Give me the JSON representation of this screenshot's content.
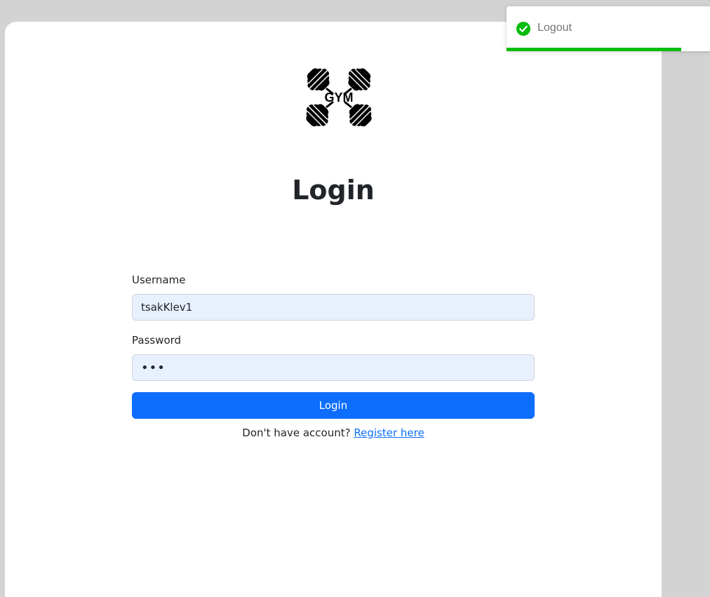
{
  "logo": {
    "text": "GYM",
    "icon": "crossed-dumbbells-icon"
  },
  "page": {
    "title": "Login"
  },
  "form": {
    "username": {
      "label": "Username",
      "value": "tsakKlev1"
    },
    "password": {
      "label": "Password",
      "value": "•••"
    },
    "submit_label": "Login"
  },
  "footer": {
    "prompt": "Don't have account?",
    "link_text": "Register here"
  },
  "toast": {
    "message": "Logout",
    "icon": "check-circle-icon",
    "progress": 0.83
  },
  "colors": {
    "accent": "#0d6efd",
    "success": "#07bc0c",
    "autofill_bg": "#e8f0fe",
    "backdrop": "#d3d3d3"
  }
}
